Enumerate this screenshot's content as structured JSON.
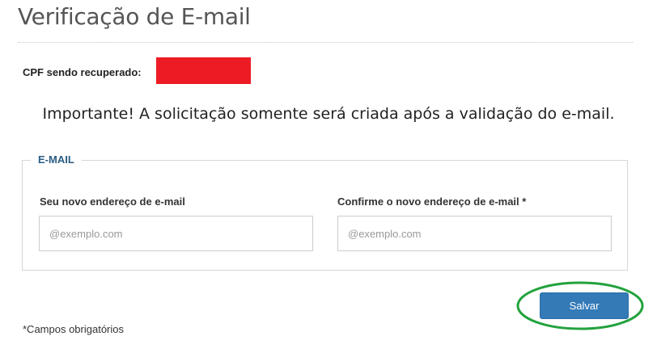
{
  "page": {
    "title": "Verificação de E-mail"
  },
  "cpf": {
    "label": "CPF sendo recuperado:",
    "redaction_color": "#ed1c24"
  },
  "notice": {
    "text": "Importante! A solicitação somente será criada após a validação do e-mail."
  },
  "email_section": {
    "legend": "E-MAIL",
    "new_email": {
      "label": "Seu novo endereço de e-mail",
      "placeholder": "@exemplo.com",
      "value": ""
    },
    "confirm_email": {
      "label": "Confirme o novo endereço de e-mail *",
      "placeholder": "@exemplo.com",
      "value": ""
    }
  },
  "actions": {
    "save_label": "Salvar",
    "save_color": "#337ab7",
    "highlight_color": "#22a23c"
  },
  "footer": {
    "required_note": "*Campos obrigatórios"
  }
}
